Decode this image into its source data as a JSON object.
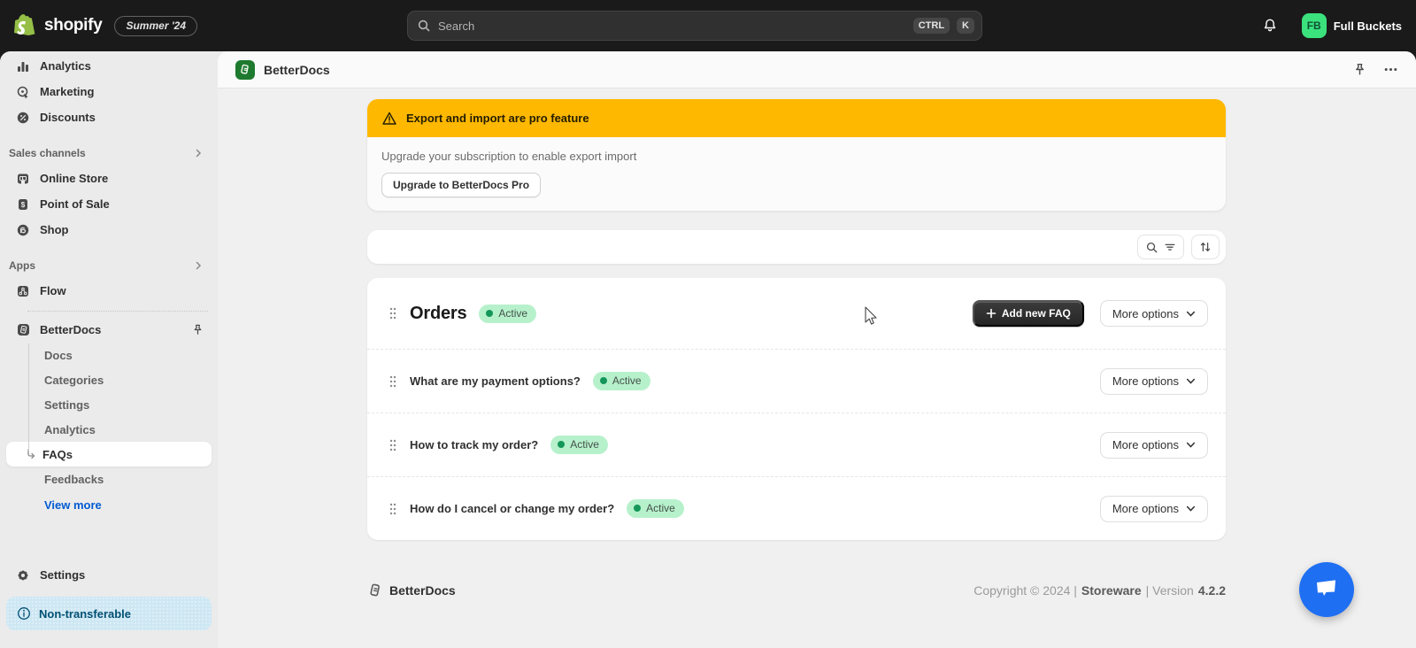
{
  "topbar": {
    "brand": "shopify",
    "edition_badge": "Summer '24",
    "search_placeholder": "Search",
    "shortcut_ctrl": "CTRL",
    "shortcut_k": "K",
    "user_initials": "FB",
    "user_name": "Full Buckets"
  },
  "sidebar": {
    "items": [
      {
        "label": "Analytics"
      },
      {
        "label": "Marketing"
      },
      {
        "label": "Discounts"
      }
    ],
    "sales_channels": {
      "label": "Sales channels",
      "items": [
        {
          "label": "Online Store"
        },
        {
          "label": "Point of Sale"
        },
        {
          "label": "Shop"
        }
      ]
    },
    "apps": {
      "label": "Apps",
      "items": [
        {
          "label": "Flow"
        }
      ]
    },
    "betterdocs": {
      "label": "BetterDocs",
      "sub_items": [
        {
          "label": "Docs"
        },
        {
          "label": "Categories"
        },
        {
          "label": "Settings"
        },
        {
          "label": "Analytics"
        },
        {
          "label": "FAQs"
        },
        {
          "label": "Feedbacks"
        }
      ],
      "active_sub_item": "FAQs",
      "view_more": "View more"
    },
    "settings_label": "Settings",
    "footer_banner": "Non-transferable"
  },
  "app_header": {
    "title": "BetterDocs"
  },
  "pro_banner": {
    "title": "Export and import are pro feature",
    "description": "Upgrade your subscription to enable export import",
    "cta": "Upgrade to BetterDocs Pro"
  },
  "faq": {
    "section_title": "Orders",
    "section_status": "Active",
    "add_button": "Add new FAQ",
    "more_options": "More options",
    "items": [
      {
        "question": "What are my payment options?",
        "status": "Active",
        "more_options": "More options"
      },
      {
        "question": "How to track my order?",
        "status": "Active",
        "more_options": "More options"
      },
      {
        "question": "How do I cancel or change my order?",
        "status": "Active",
        "more_options": "More options"
      }
    ]
  },
  "footer": {
    "brand": "BetterDocs",
    "copyright": "Copyright © 2024 |",
    "storeware": "Storeware",
    "version_label": "| Version",
    "version": "4.2.2"
  },
  "colors": {
    "topbar_bg": "#1a1a1a",
    "accent_green": "#3be17d",
    "warning_yellow": "#ffb800",
    "active_badge_bg": "#b7f1cc",
    "active_badge_dot": "#15965a",
    "link_blue": "#005bd3",
    "chat_blue": "#1f6ff2",
    "app_icon_green": "#1d7a2e"
  }
}
